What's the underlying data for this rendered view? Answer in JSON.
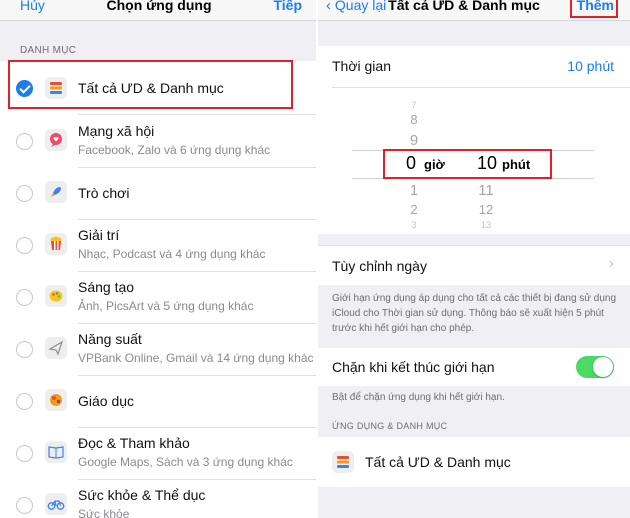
{
  "left": {
    "nav": {
      "cancel": "Hủy",
      "title": "Chọn ứng dụng",
      "next": "Tiếp"
    },
    "section_header": "DANH MỤC",
    "items": [
      {
        "title": "Tất cả ƯD & Danh mục",
        "subtitle": "",
        "checked": true,
        "icon": "stack-icon"
      },
      {
        "title": "Mạng xã hội",
        "subtitle": "Facebook, Zalo và 6 ứng dụng khác",
        "checked": false,
        "icon": "chat-heart-icon"
      },
      {
        "title": "Trò chơi",
        "subtitle": "",
        "checked": false,
        "icon": "rocket-icon"
      },
      {
        "title": "Giải trí",
        "subtitle": "Nhạc, Podcast và 4 ứng dụng khác",
        "checked": false,
        "icon": "popcorn-icon"
      },
      {
        "title": "Sáng tạo",
        "subtitle": "Ảnh, PicsArt và 5 ứng dụng khác",
        "checked": false,
        "icon": "palette-icon"
      },
      {
        "title": "Năng suất",
        "subtitle": "VPBank Online, Gmail và 14 ứng dụng khác",
        "checked": false,
        "icon": "paper-plane-icon"
      },
      {
        "title": "Giáo dục",
        "subtitle": "",
        "checked": false,
        "icon": "globe-icon"
      },
      {
        "title": "Đọc & Tham khảo",
        "subtitle": "Google Maps, Sách và 3 ứng dụng khác",
        "checked": false,
        "icon": "book-icon"
      },
      {
        "title": "Sức khỏe & Thể dục",
        "subtitle": "Sức khỏe",
        "checked": false,
        "icon": "bicycle-icon"
      }
    ]
  },
  "right": {
    "nav": {
      "back": "Quay lại",
      "title": "Tất cả ƯD & Danh mục",
      "add": "Thêm"
    },
    "time_label": "Thời gian",
    "time_value": "10 phút",
    "picker": {
      "hours_above": [
        "7",
        "8",
        "9"
      ],
      "hours_value": "0",
      "hours_unit": "giờ",
      "hours_below": [
        "1",
        "2",
        "3"
      ],
      "minutes_value": "10",
      "minutes_unit": "phút",
      "minutes_below": [
        "11",
        "12",
        "13"
      ]
    },
    "custom_days": "Tùy chỉnh ngày",
    "limit_note": "Giới hạn ứng dụng áp dụng cho tất cả các thiết bị đang sử dụng iCloud cho Thời gian sử dụng. Thông báo sẽ xuất hiện 5 phút trước khi hết giới hạn cho phép.",
    "block_label": "Chặn khi kết thúc giới hạn",
    "block_on": true,
    "block_note": "Bật để chặn ứng dụng khi hết giới hạn.",
    "apps_header": "ỨNG DỤNG & DANH MỤC",
    "app_item": "Tất cả ƯD & Danh mục"
  },
  "colors": {
    "accent": "#1f7cf0",
    "highlight": "#e12127",
    "toggle_on": "#4cd964",
    "grouped_bg": "#efeff4"
  }
}
